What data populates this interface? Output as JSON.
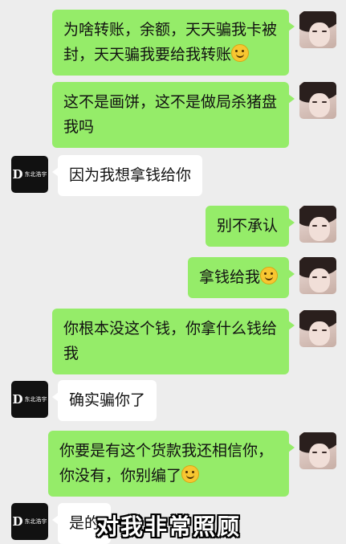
{
  "messages": [
    {
      "sender": "me",
      "text": "为啥转账，余额，天天骗我卡被封，天天骗我要给我转账",
      "emoji": "smile-emoji"
    },
    {
      "sender": "me",
      "text": "这不是画饼，这不是做局杀猪盘我吗"
    },
    {
      "sender": "other",
      "text": "因为我想拿钱给你"
    },
    {
      "sender": "me",
      "text": "别不承认"
    },
    {
      "sender": "me",
      "text": "拿钱给我",
      "emoji": "smile-emoji"
    },
    {
      "sender": "me",
      "text": "你根本没这个钱，你拿什么钱给我"
    },
    {
      "sender": "other",
      "text": "确实骗你了"
    },
    {
      "sender": "me",
      "text": "你要是有这个货款我还相信你，你没有，你别编了",
      "emoji": "smile-emoji"
    },
    {
      "sender": "other",
      "text": "是的"
    }
  ],
  "other_avatar": {
    "logo": "D",
    "text": "东北浩宇"
  },
  "caption": "对我非常照顾",
  "colors": {
    "background": "#ededed",
    "my_bubble": "#95ec69",
    "other_bubble": "#ffffff"
  }
}
